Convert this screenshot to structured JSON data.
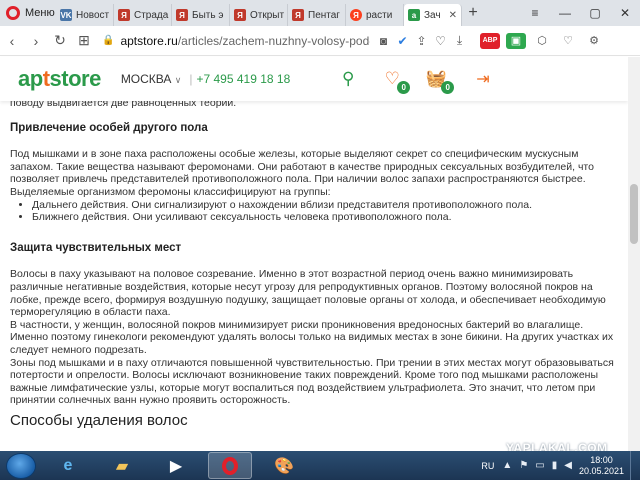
{
  "browser": {
    "menu_label": "Меню",
    "tabs": [
      {
        "label": "Новост",
        "favicon": "VK",
        "color": "#4a76a8"
      },
      {
        "label": "Страда",
        "favicon": "Я",
        "color": "#c0392b"
      },
      {
        "label": "Быть э",
        "favicon": "Я",
        "color": "#c0392b"
      },
      {
        "label": "Открыт",
        "favicon": "Я",
        "color": "#c0392b"
      },
      {
        "label": "Пентаг",
        "favicon": "Я",
        "color": "#c0392b"
      },
      {
        "label": "расти",
        "favicon": "Я",
        "color": "#fc3f1d"
      },
      {
        "label": "Зач",
        "favicon": "a",
        "color": "#2b9a4a",
        "active": true
      }
    ],
    "url_domain": "aptstore.ru",
    "url_path": "/articles/zachem-nuzhny-volosy-pod-",
    "ext_badge": "1"
  },
  "site": {
    "logo_main": "ap",
    "logo_accent": "t",
    "logo_tail": "store",
    "city": "МОСКВА",
    "phone": "+7 495 419 18 18",
    "favorites_count": "0",
    "cart_count": "0",
    "brand_green": "#2b9a4a",
    "brand_orange": "#ef6b1f"
  },
  "article": {
    "intro_tail": "поводу выдвигается две равноценных теории.",
    "section1_title": "Привлечение особей другого пола",
    "section1_p1": "Под мышками и в зоне паха расположены особые железы, которые выделяют секрет со специфическим мускусным запахом. Такие вещества называют феромонами. Они работают в качестве природных сексуальных возбудителей, что позволяет привлечь представителей противоположного пола. При наличии волос запахи распространяются быстрее.",
    "section1_p2": "Выделяемые организмом феромоны классифицируют на группы:",
    "section1_list": [
      "Дальнего действия. Они сигнализируют о нахождении вблизи представителя противоположного пола.",
      "Ближнего действия. Они усиливают сексуальность человека противоположного пола."
    ],
    "section2_title": "Защита чувствительных мест",
    "section2_p1": "Волосы в паху указывают на половое созревание. Именно в этот возрастной период очень важно минимизировать различные негативные воздействия, которые несут угрозу для репродуктивных органов. Поэтому волосяной покров на лобке, прежде всего, формируя воздушную подушку, защищает половые органы от холода, и обеспечивает необходимую терморегуляцию в области паха.",
    "section2_p2": "В частности, у женщин, волосяной покров минимизирует риски проникновения вредоносных бактерий во влагалище. Именно поэтому гинекологи рекомендуют удалять волосы только на видимых местах в зоне бикини. На других участках их следует немного подрезать.",
    "section2_p3": "Зоны под мышками и в паху отличаются повышенной чувствительностью. При трении в этих местах могут образовываться потертости и опрелости. Волосы исключают возникновение таких повреждений. Кроме того под мышками расположены важные лимфатические узлы, которые могут воспалиться под воздействием ультрафиолета. Это значит, что летом при принятии солнечных ванн нужно проявить осторожность.",
    "section3_title": "Способы удаления волос"
  },
  "watermark": "YAPLAKAL.COM",
  "taskbar": {
    "lang": "RU",
    "time": "18:00",
    "date": "20.05.2021"
  }
}
